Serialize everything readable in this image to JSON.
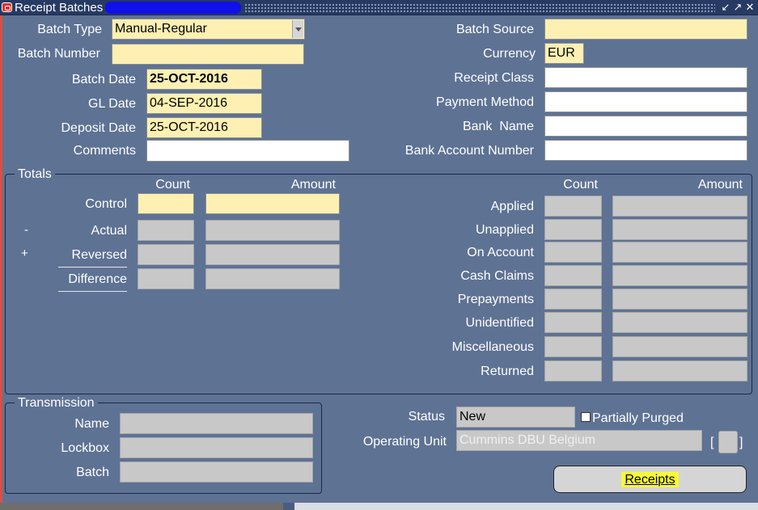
{
  "window": {
    "title": "Receipt Batches",
    "title_suffix": "("
  },
  "header": {
    "batch_type_label": "Batch Type",
    "batch_type_value": "Manual-Regular",
    "batch_number_label": "Batch Number",
    "batch_number_value": "",
    "batch_date_label": "Batch Date",
    "batch_date_value": "25-OCT-2016",
    "gl_date_label": "GL Date",
    "gl_date_value": "04-SEP-2016",
    "deposit_date_label": "Deposit Date",
    "deposit_date_value": "25-OCT-2016",
    "comments_label": "Comments",
    "comments_value": "",
    "batch_source_label": "Batch Source",
    "batch_source_value": "",
    "currency_label": "Currency",
    "currency_value": "EUR",
    "receipt_class_label": "Receipt Class",
    "payment_method_label": "Payment Method",
    "bank_name_label": "Bank  Name",
    "bank_account_label": "Bank Account Number"
  },
  "totals": {
    "title": "Totals",
    "count_header": "Count",
    "amount_header": "Amount",
    "left_rows": [
      "Control",
      "Actual",
      "Reversed",
      "Difference"
    ],
    "minus_sign": "-",
    "plus_sign": "+",
    "right_rows": [
      "Applied",
      "Unapplied",
      "On Account",
      "Cash Claims",
      "Prepayments",
      "Unidentified",
      "Miscellaneous",
      "Returned"
    ]
  },
  "transmission": {
    "title": "Transmission",
    "name_label": "Name",
    "lockbox_label": "Lockbox",
    "batch_label": "Batch"
  },
  "status": {
    "status_label": "Status",
    "status_value": "New",
    "partially_purged_label": "Partially Purged",
    "partially_purged_checked": false,
    "operating_unit_label": "Operating Unit",
    "operating_unit_value": "Cummins DBU Belgium",
    "bracket_open": "[",
    "bracket_close": "]"
  },
  "buttons": {
    "receipts": "Receipts"
  },
  "colors": {
    "canvas": "#5e7294",
    "titlebar": "#273a63",
    "required_field": "#fdf0b2",
    "readonly_field": "#c8c8c8",
    "highlight": "#f8f837"
  }
}
